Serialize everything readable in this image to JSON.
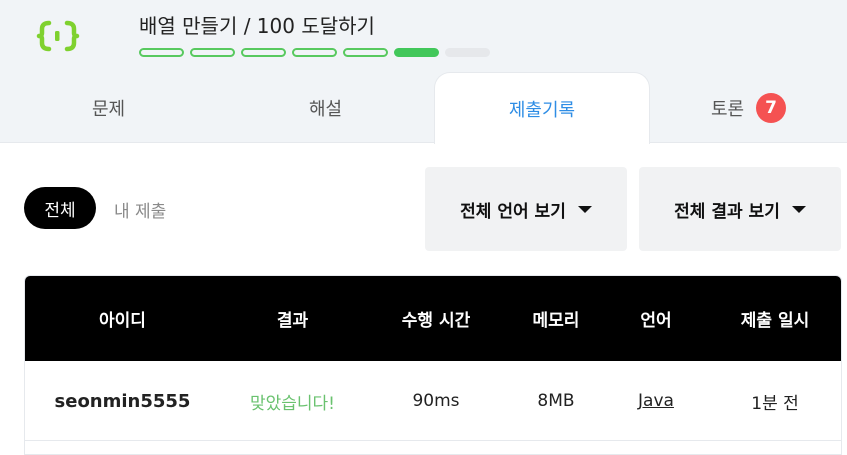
{
  "header": {
    "logo_icon": "braces-logo-icon",
    "title": "배열 만들기 / 100 도달하기",
    "progress": {
      "total_steps": 7,
      "completed_steps": 5,
      "current_step": 6
    },
    "colors": {
      "progress_green": "#42c75a",
      "active_tab": "#2e8de5",
      "badge": "#f55252"
    }
  },
  "tabs": [
    {
      "label": "문제"
    },
    {
      "label": "해설"
    },
    {
      "label": "제출기록",
      "active": true
    },
    {
      "label": "토론",
      "badge": "7"
    }
  ],
  "filters": {
    "all_label": "전체",
    "mine_label": "내 제출",
    "language_dropdown": "전체 언어 보기",
    "result_dropdown": "전체 결과 보기"
  },
  "table": {
    "headers": [
      "아이디",
      "결과",
      "수행 시간",
      "메모리",
      "언어",
      "제출 일시"
    ],
    "rows": [
      {
        "id": "seonmin5555",
        "result": "맞았습니다!",
        "time": "90ms",
        "memory": "8MB",
        "language": "Java",
        "submitted": "1분 전"
      }
    ]
  }
}
